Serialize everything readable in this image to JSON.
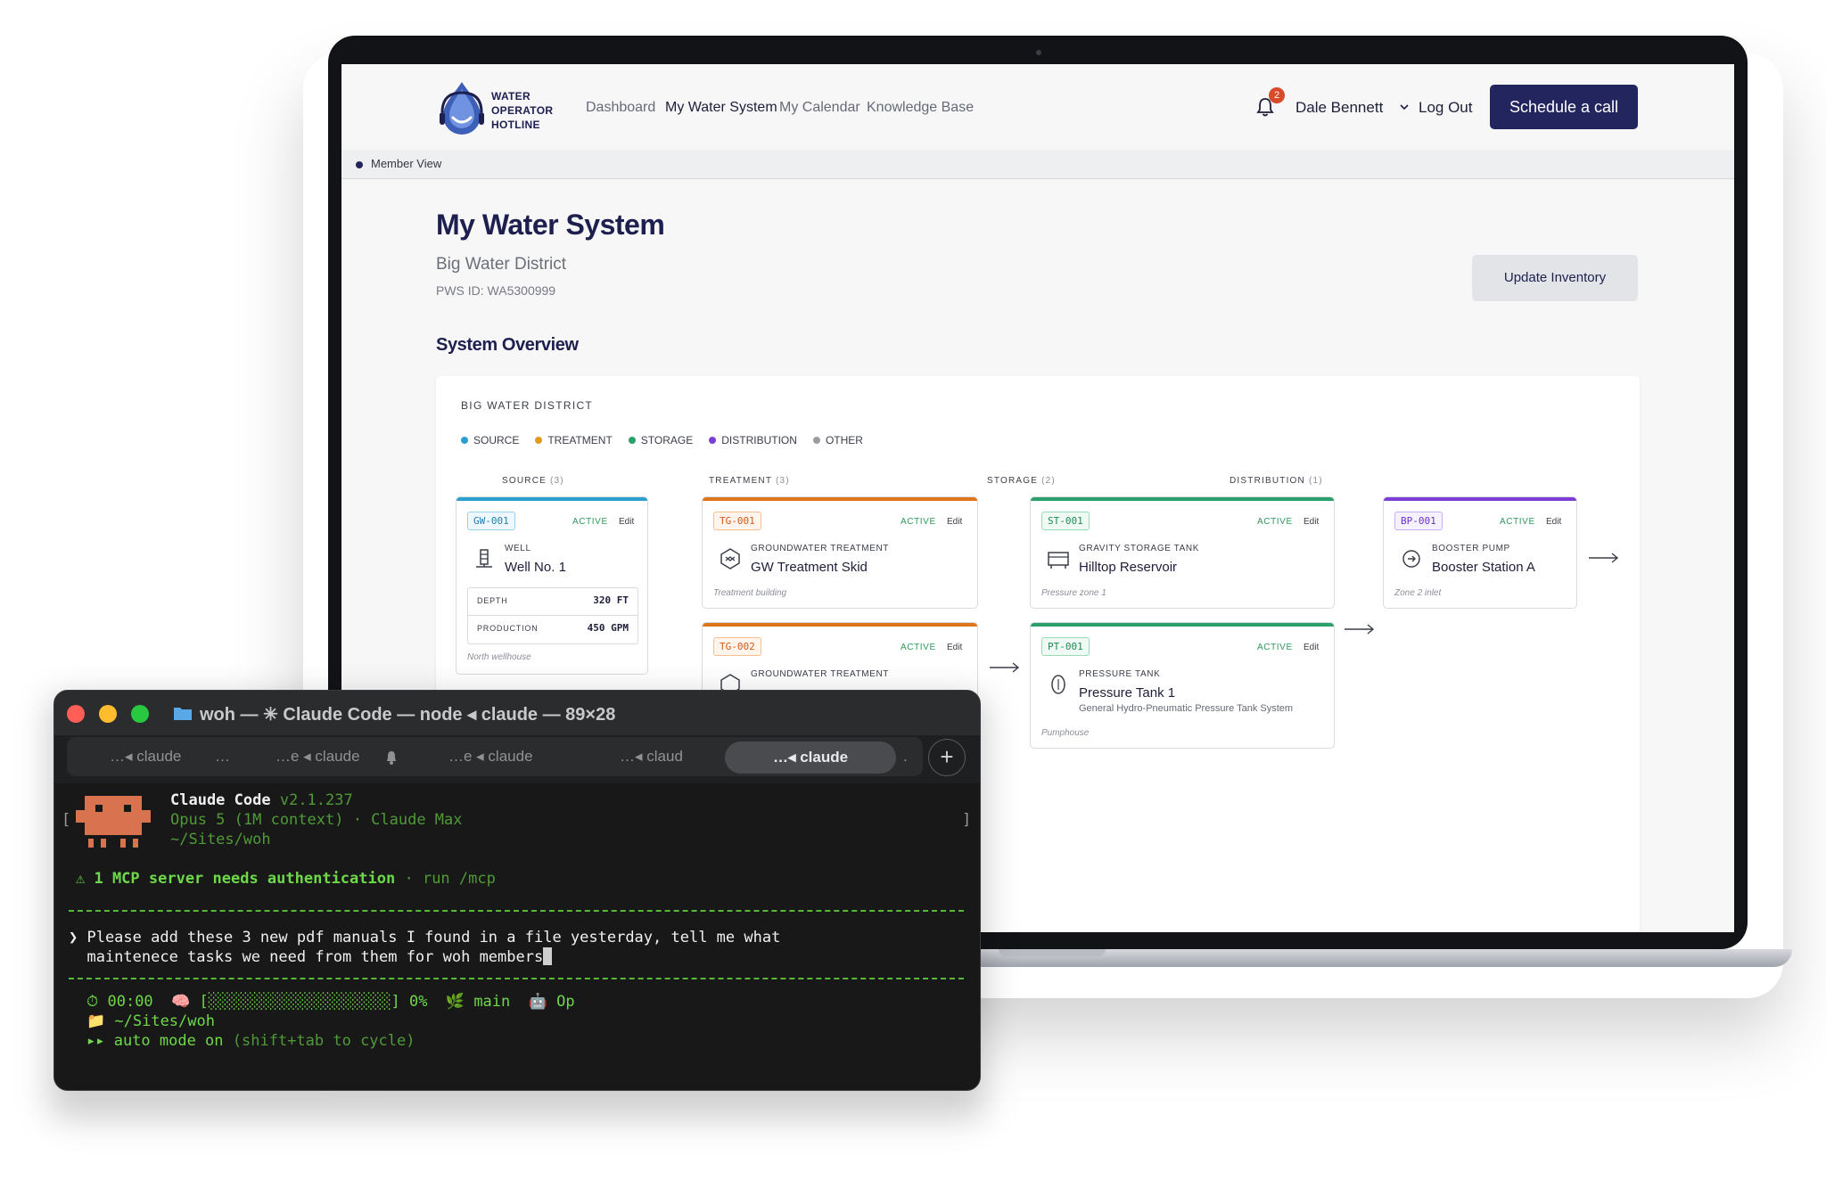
{
  "site": {
    "logo_lines": [
      "WATER",
      "OPERATOR",
      "HOTLINE"
    ],
    "nav": {
      "links": [
        "Dashboard",
        "My Water System",
        "My Calendar",
        "Knowledge Base"
      ],
      "active_index": 1,
      "notification_count": "2",
      "user_name": "Dale Bennett",
      "logout_label": "Log Out",
      "cta_label": "Schedule a call"
    },
    "member_view_label": "Member View",
    "page_title": "My Water System",
    "district_name": "Big Water District",
    "pws_id": "PWS ID: WA5300999",
    "update_button_label": "Update Inventory",
    "section_title": "System Overview",
    "panel": {
      "title": "BIG WATER DISTRICT",
      "legend": [
        {
          "label": "SOURCE",
          "color": "#2a9fd0"
        },
        {
          "label": "TREATMENT",
          "color": "#e59a1a"
        },
        {
          "label": "STORAGE",
          "color": "#2aa06a"
        },
        {
          "label": "DISTRIBUTION",
          "color": "#7b3fd6"
        },
        {
          "label": "OTHER",
          "color": "#9a9ca3"
        }
      ],
      "columns": [
        {
          "label": "SOURCE",
          "count": "(3)"
        },
        {
          "label": "TREATMENT",
          "count": "(3)"
        },
        {
          "label": "STORAGE",
          "count": "(2)"
        },
        {
          "label": "DISTRIBUTION",
          "count": "(1)"
        }
      ],
      "cards": {
        "gw001": {
          "code": "GW-001",
          "status": "ACTIVE",
          "edit": "Edit",
          "type": "WELL",
          "name": "Well No. 1",
          "depth_label": "DEPTH",
          "depth_value": "320 FT",
          "production_label": "PRODUCTION",
          "production_value": "450 GPM",
          "location": "North wellhouse"
        },
        "tg001": {
          "code": "TG-001",
          "status": "ACTIVE",
          "edit": "Edit",
          "type": "GROUNDWATER TREATMENT",
          "name": "GW Treatment Skid",
          "location": "Treatment building"
        },
        "tg002": {
          "code": "TG-002",
          "status": "ACTIVE",
          "edit": "Edit",
          "type": "GROUNDWATER TREATMENT"
        },
        "st001": {
          "code": "ST-001",
          "status": "ACTIVE",
          "edit": "Edit",
          "type": "GRAVITY STORAGE TANK",
          "name": "Hilltop Reservoir",
          "location": "Pressure zone 1"
        },
        "pt001": {
          "code": "PT-001",
          "status": "ACTIVE",
          "edit": "Edit",
          "type": "PRESSURE TANK",
          "name": "Pressure Tank 1",
          "description": "General Hydro-Pneumatic Pressure Tank System",
          "location": "Pumphouse"
        },
        "bp001": {
          "code": "BP-001",
          "status": "ACTIVE",
          "edit": "Edit",
          "type": "BOOSTER PUMP",
          "name": "Booster Station A",
          "location": "Zone 2 inlet"
        }
      }
    }
  },
  "terminal": {
    "window_title": "woh — ✳ Claude Code — node ◂ claude — 89×28",
    "tabs": [
      "…◂ claude",
      "…e ◂ claude",
      "…e ◂ claude",
      "…◂ claud",
      "…◂ claude"
    ],
    "tab_ellipses": [
      "…",
      "."
    ],
    "active_tab_index": 4,
    "header": {
      "app_name": "Claude Code",
      "version": "v2.1.237",
      "model_line": "Opus 5 (1M context) · Claude Max",
      "cwd": "~/Sites/woh"
    },
    "warning": "⚠ 1 MCP server needs authentication",
    "warning_hint": "· run /mcp",
    "prompt_line1": "❯ Please add these 3 new pdf manuals I found in a file yesterday, tell me what",
    "prompt_line2": "  maintenece tasks we need from them for woh members",
    "status_timer": "⏱ 00:00",
    "status_context": "🧠 [░░░░░░░░░░░░░░░░░░░░] 0%",
    "status_branch": "🌿 main",
    "status_model": "🤖 Op",
    "status_cwd": "📁 ~/Sites/woh",
    "mode_prefix": "▸▸ auto mode on",
    "mode_hint": "(shift+tab to cycle)",
    "colors": {
      "green": "#6ed84a",
      "bg": "#181818"
    }
  }
}
